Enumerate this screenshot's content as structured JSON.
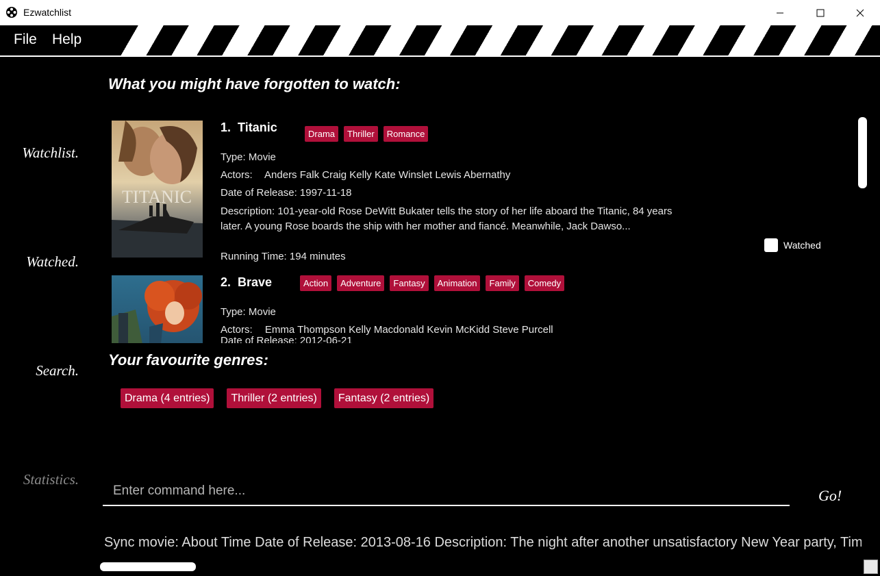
{
  "window": {
    "title": "Ezwatchlist"
  },
  "menu": {
    "file": "File",
    "help": "Help"
  },
  "sidebar": {
    "watchlist": "Watchlist.",
    "watched": "Watched.",
    "search": "Search.",
    "statistics": "Statistics."
  },
  "statistics": {
    "forgotten_title": "What you might have forgotten to watch:",
    "genres_title": "Your favourite genres:",
    "movies": [
      {
        "index": "1.",
        "title": "Titanic",
        "tags": [
          "Drama",
          "Thriller",
          "Romance"
        ],
        "type": "Type: Movie",
        "actors_label": "Actors:",
        "actors": [
          "Anders Falk",
          "Craig Kelly",
          "Kate Winslet",
          "Lewis Abernathy"
        ],
        "release": "Date of Release: 1997-11-18",
        "description": "Description: 101-year-old Rose DeWitt Bukater tells the story of her life aboard the Titanic, 84 years later. A young Rose boards the ship with her mother and fiancé. Meanwhile, Jack Dawso...",
        "running_time": "Running Time: 194 minutes",
        "poster_text": "TITANIC",
        "watched_label": "Watched",
        "watched": false
      },
      {
        "index": "2.",
        "title": "Brave",
        "tags": [
          "Action",
          "Adventure",
          "Fantasy",
          "Animation",
          "Family",
          "Comedy"
        ],
        "type": "Type: Movie",
        "actors_label": "Actors:",
        "actors": [
          "Emma Thompson",
          "Kelly Macdonald",
          "Kevin McKidd",
          "Steve Purcell"
        ],
        "release": "Date of Release: 2012-06-21"
      }
    ],
    "genres": [
      "Drama (4 entries)",
      "Thriller (2 entries)",
      "Fantasy (2 entries)"
    ]
  },
  "command": {
    "placeholder": "Enter command here...",
    "go_label": "Go!"
  },
  "result": {
    "text": "Sync movie: About Time Date of Release: 2013-08-16 Description: The night after another unsatisfactory New Year party, Tim learns a shocking secret from his father"
  },
  "colors": {
    "tag": "#b0103a",
    "background": "#000000"
  }
}
